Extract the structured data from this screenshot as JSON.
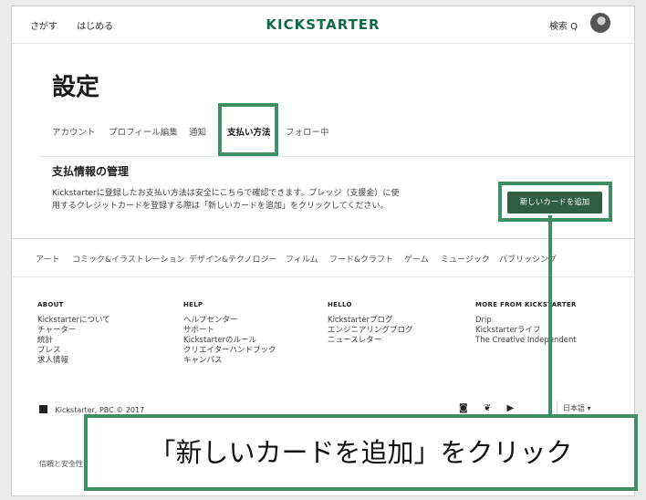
{
  "header": {
    "nav_links": [
      "さがす",
      "はじめる"
    ],
    "logo_text": "KICKSTARTER",
    "search_label": "検索 Q"
  },
  "page": {
    "title": "設定",
    "tabs": [
      {
        "label": "アカウント"
      },
      {
        "label": "プロフィール編集"
      },
      {
        "label": "通知"
      },
      {
        "label": "支払い方法"
      },
      {
        "label": "フォロー中"
      }
    ],
    "active_tab": "支払い方法",
    "section_heading": "支払情報の管理",
    "description_line1": "Kickstarterに登録したお支払い方法は安全にこちらで確認できます。プレッジ（支援金）に使",
    "description_line2": "用するクレジットカードを登録する際は「新しいカードを追加」をクリックしてください。",
    "add_card_button": "新しいカードを追加"
  },
  "categories": [
    "アート",
    "コミック&イラストレーション",
    "デザイン&テクノロジー",
    "フィルム",
    "フード&クラフト",
    "ゲーム",
    "ミュージック",
    "パブリッシング"
  ],
  "footer": {
    "columns": [
      {
        "heading": "ABOUT",
        "items": [
          "Kickstarterについて",
          "チャーター",
          "統計",
          "プレス",
          "求人情報"
        ]
      },
      {
        "heading": "HELP",
        "items": [
          "ヘルプセンター",
          "サポート",
          "Kickstarterのルール",
          "クリエイターハンドブック",
          "キャンパス"
        ]
      },
      {
        "heading": "HELLO",
        "items": [
          "Kickstarterブログ",
          "エンジニアリングブログ",
          "ニュースレター"
        ]
      },
      {
        "heading": "MORE FROM KICKSTARTER",
        "items": [
          "Drip",
          "Kickstarterライフ",
          "The Creative Independent"
        ]
      }
    ],
    "copyright": "Kickstarter, PBC © 2017",
    "language": "日本語 ▾",
    "bottom_link": "信頼と安全性"
  },
  "annotation": {
    "callout_text": "「新しいカードを追加」をクリック",
    "color": "#3f8f64"
  }
}
